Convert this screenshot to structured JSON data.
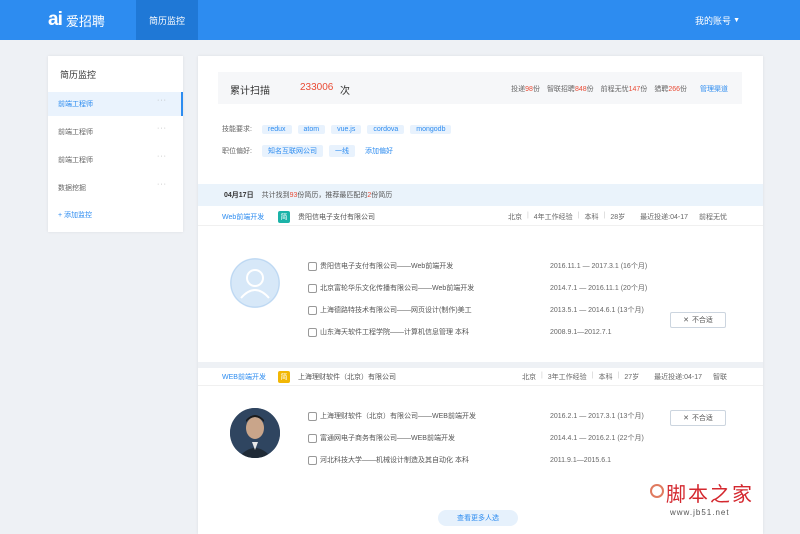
{
  "app": {
    "logo_mark": "ai",
    "logo_text": "爱招聘",
    "active_tab": "简历监控",
    "account_label": "我的账号"
  },
  "sidebar": {
    "title": "简历监控",
    "items": [
      {
        "label": "前端工程师",
        "more": "···"
      },
      {
        "label": "前端工程师",
        "more": "···"
      },
      {
        "label": "前端工程师",
        "more": "···"
      },
      {
        "label": "数据挖掘",
        "more": "···"
      }
    ],
    "add_label": "+ 添加监控"
  },
  "summary": {
    "label": "累计扫描",
    "count": "233006",
    "unit": "次",
    "stats": [
      {
        "prefix": "投递",
        "value": "98",
        "suffix": "份"
      },
      {
        "prefix": "智联招聘",
        "value": "848",
        "suffix": "份"
      },
      {
        "prefix": "前程无忧",
        "value": "147",
        "suffix": "份"
      },
      {
        "prefix": "猎聘",
        "value": "266",
        "suffix": "份"
      }
    ],
    "manage_link": "管理渠道"
  },
  "filters": {
    "skills_label": "技能要求:",
    "skills": [
      "redux",
      "atom",
      "vue.js",
      "cordova",
      "mongodb"
    ],
    "positions_label": "职位偏好:",
    "positions": [
      "知名互联网公司",
      "一线"
    ],
    "add_preference": "添加偏好"
  },
  "date_strip": {
    "date": "04月17日",
    "text_pre": "共计找到",
    "found": "93",
    "text_mid": "份简历，推荐最匹配的",
    "matched": "2",
    "text_post": "份简历"
  },
  "resumes": [
    {
      "job": "Web前端开发",
      "badge": "简",
      "badge_color": "#1bb3a8",
      "company": "贵阳信电子支付有限公司",
      "meta": [
        "北京",
        "4年工作经验",
        "本科",
        "28岁",
        "最近投递:04-17",
        "前程无忧"
      ],
      "experience": [
        {
          "text": "贵阳信电子支付有限公司——Web前端开发",
          "period": "2016.11.1 — 2017.3.1 (16个月)"
        },
        {
          "text": "北京富轮华乐文化传播有限公司——Web前端开发",
          "period": "2014.7.1 — 2016.11.1 (20个月)"
        },
        {
          "text": "上海德路特技术有限公司——网页设计(制作)美工",
          "period": "2013.5.1 — 2014.6.1 (13个月)"
        },
        {
          "text": "山东海天软件工程学院——计算机信息管理 本科",
          "period": "2008.9.1—2012.7.1"
        }
      ],
      "unfit_label": "不合适"
    },
    {
      "job": "WEB前端开发",
      "badge": "简",
      "badge_color": "#f2b705",
      "company": "上海理财软件（北京）有限公司",
      "meta": [
        "北京",
        "3年工作经验",
        "本科",
        "27岁",
        "最近投递:04-17",
        "智联"
      ],
      "experience": [
        {
          "text": "上海理财软件（北京）有限公司——WEB前端开发",
          "period": "2016.2.1 — 2017.3.1 (13个月)"
        },
        {
          "text": "富通网电子商务有限公司——WEB前端开发",
          "period": "2014.4.1 — 2016.2.1 (22个月)"
        },
        {
          "text": "河北科技大学——机械设计制造及其自动化 本科",
          "period": "2011.9.1—2015.6.1"
        }
      ],
      "unfit_label": "不合适"
    }
  ],
  "more_button": "查看更多人选",
  "watermark": {
    "main": "脚本之家",
    "sub": "www.jb51.net"
  }
}
